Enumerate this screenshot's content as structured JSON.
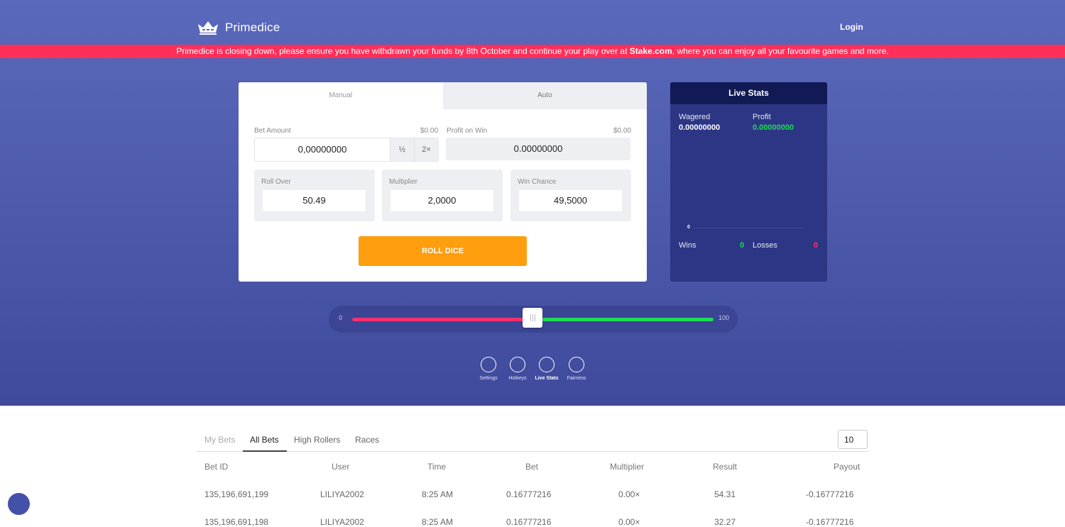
{
  "header": {
    "brand": "Primedice",
    "login": "Login"
  },
  "banner": {
    "pre": "Primedice is closing down, please ensure you have withdrawn your funds by 8th October and continue your play over at ",
    "link": "Stake.com",
    "post": ", where you can enjoy all your favourite games and more."
  },
  "game": {
    "tabs": [
      "Manual",
      "Auto"
    ],
    "bet_amount_label": "Bet Amount",
    "bet_amount_usd": "$0.00",
    "bet_amount_value": "0,00000000",
    "half_label": "½",
    "double_label": "2×",
    "profit_label": "Profit on Win",
    "profit_usd": "$0.00",
    "profit_value": "0.00000000",
    "roll_over_label": "Roll Over",
    "roll_over_value": "50.49",
    "multiplier_label": "Multiplier",
    "multiplier_value": "2,0000",
    "win_chance_label": "Win Chance",
    "win_chance_value": "49,5000",
    "roll_button": "ROLL DICE"
  },
  "live_stats": {
    "title": "Live Stats",
    "wagered_label": "Wagered",
    "wagered_value": "0.00000000",
    "profit_label": "Profit",
    "profit_value": "0.00000000",
    "chart_zero": "0",
    "wins_label": "Wins",
    "wins_value": "0",
    "losses_label": "Losses",
    "losses_value": "0"
  },
  "slider": {
    "min": "0",
    "max": "100",
    "position": 50.49
  },
  "controls": [
    "Settings",
    "Hotkeys",
    "Live Stats",
    "Fairness"
  ],
  "bets": {
    "tabs": [
      "My Bets",
      "All Bets",
      "High Rollers",
      "Races"
    ],
    "count": "10",
    "columns": [
      "Bet ID",
      "User",
      "Time",
      "Bet",
      "Multiplier",
      "Result",
      "Payout"
    ],
    "rows": [
      [
        "135,196,691,199",
        "LILIYA2002",
        "8:25 AM",
        "0.16777216",
        "0.00×",
        "54.31",
        "-0.16777216"
      ],
      [
        "135,196,691,198",
        "LILIYA2002",
        "8:25 AM",
        "0.16777216",
        "0.00×",
        "32.27",
        "-0.16777216"
      ]
    ]
  },
  "colors": {
    "accent": "#ff9e0e",
    "banner": "#ff2f5a",
    "win": "#1fdb57",
    "loss": "#ff2f6d"
  }
}
